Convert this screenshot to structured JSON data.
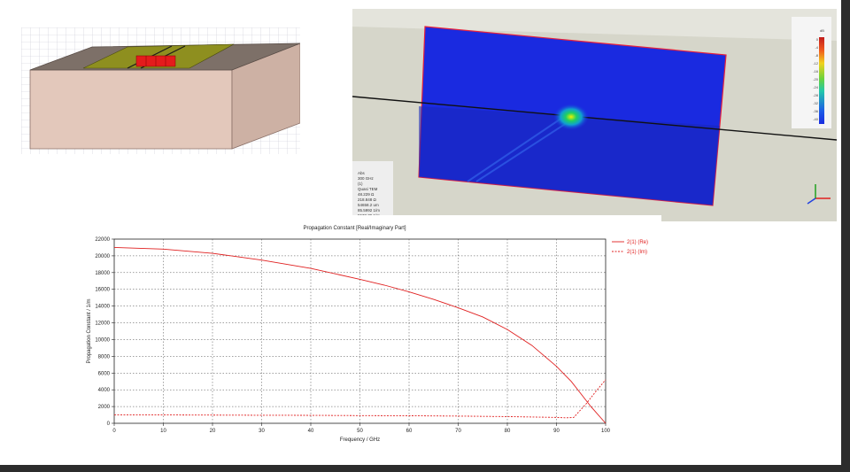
{
  "model_view": {},
  "field_view": {
    "info_lines": [
      "Abs",
      "300 GHz",
      "(1)",
      "Quasi TEM",
      "48.229 Ω",
      "218.848 Ω",
      "54658.2 um",
      "85.5992 1/m",
      "5573.79 1/m",
      "1e-06"
    ],
    "colorbar": {
      "unit": "dB",
      "ticks": [
        "0",
        "-4",
        "-8",
        "-12",
        "-16",
        "-20",
        "-24",
        "-28",
        "-32",
        "-36",
        "-40"
      ]
    }
  },
  "chart_data": {
    "type": "line",
    "title": "Propagation Constant [Real/Imaginary Part]",
    "xlabel": "Frequency / GHz",
    "ylabel": "Propagation Constant / 1/m",
    "xlim": [
      0,
      100
    ],
    "ylim": [
      0,
      22000
    ],
    "x_ticks": [
      "0",
      "10",
      "20",
      "30",
      "40",
      "50",
      "60",
      "70",
      "80",
      "90",
      "100"
    ],
    "y_ticks": [
      "0",
      "2000",
      "4000",
      "6000",
      "8000",
      "10000",
      "12000",
      "14000",
      "16000",
      "18000",
      "20000",
      "22000"
    ],
    "grid": true,
    "legend_position": "right",
    "series": [
      {
        "name": "2(1) (Re)",
        "style": "solid",
        "color": "#e02020",
        "x": [
          0,
          10,
          20,
          30,
          40,
          50,
          55,
          60,
          65,
          70,
          75,
          80,
          85,
          90,
          93,
          95,
          97,
          100
        ],
        "y": [
          21000,
          20800,
          20300,
          19500,
          18500,
          17200,
          16500,
          15700,
          14800,
          13800,
          12700,
          11200,
          9300,
          6800,
          5000,
          3500,
          2000,
          0
        ]
      },
      {
        "name": "2(1) (Im)",
        "style": "dashed",
        "color": "#e02020",
        "x": [
          0,
          10,
          20,
          30,
          40,
          50,
          60,
          70,
          80,
          90,
          92,
          93.5,
          96,
          98,
          100
        ],
        "y": [
          1000,
          1000,
          980,
          960,
          950,
          920,
          900,
          860,
          800,
          700,
          650,
          700,
          2300,
          3800,
          5200
        ]
      }
    ]
  }
}
